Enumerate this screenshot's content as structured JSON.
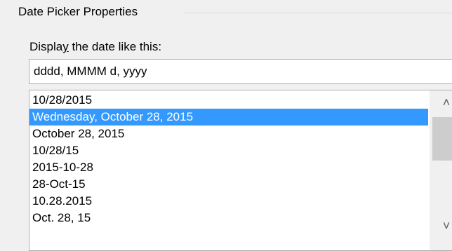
{
  "group": {
    "title": "Date Picker Properties"
  },
  "display_format": {
    "label_before": "Display the date like this",
    "label_accel": "y",
    "label_after": " the date like this:",
    "label_part1": "Displa",
    "value": "dddd, MMMM d, yyyy"
  },
  "format_list": {
    "items": [
      {
        "label": "10/28/2015",
        "selected": false
      },
      {
        "label": "Wednesday, October 28, 2015",
        "selected": true
      },
      {
        "label": "October 28, 2015",
        "selected": false
      },
      {
        "label": "10/28/15",
        "selected": false
      },
      {
        "label": "2015-10-28",
        "selected": false
      },
      {
        "label": "28-Oct-15",
        "selected": false
      },
      {
        "label": "10.28.2015",
        "selected": false
      },
      {
        "label": "Oct. 28, 15",
        "selected": false
      }
    ]
  },
  "scrollbar": {
    "up_icon": "chevron-up-icon",
    "down_icon": "chevron-down-icon"
  },
  "colors": {
    "selection": "#3399ff",
    "selection_text": "#ffffff",
    "background": "#f0f0f0"
  }
}
